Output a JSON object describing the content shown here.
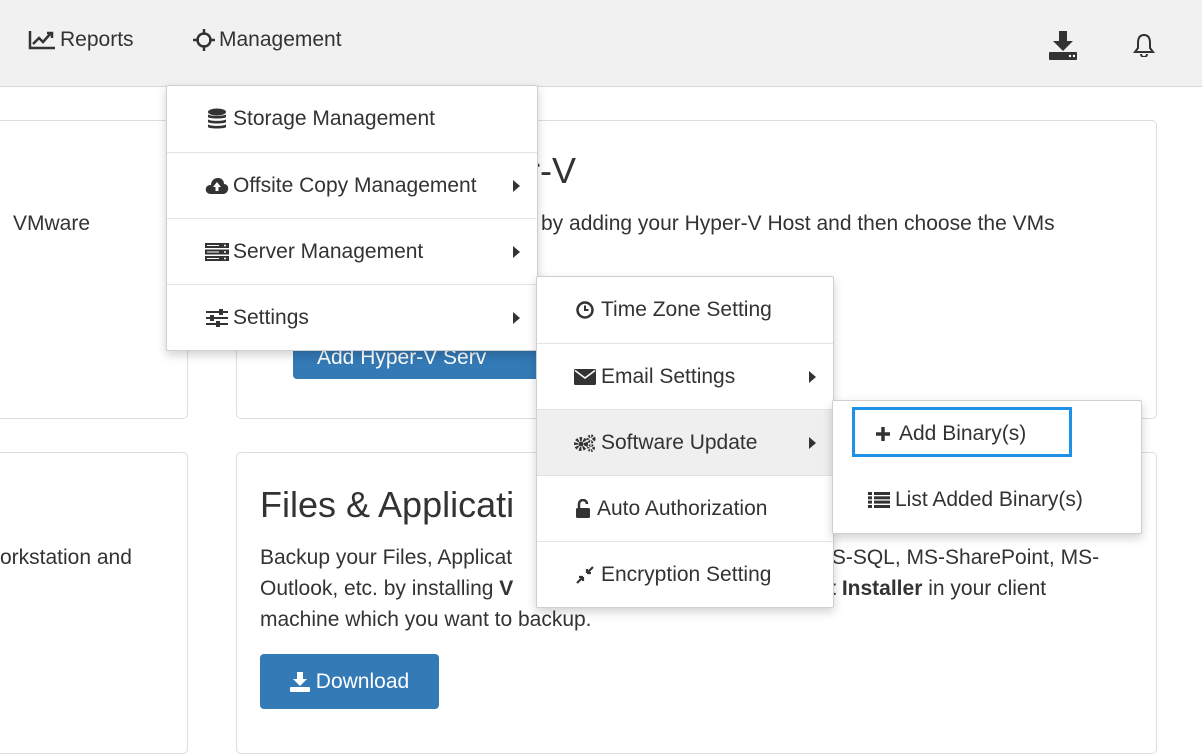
{
  "nav": {
    "reports_label": "Reports",
    "management_label": "Management"
  },
  "background": {
    "left_panel_top_text": "VMware",
    "left_panel_bottom_text": "orkstation and",
    "hyperv_title": "r-V",
    "hyperv_desc": "by adding your Hyper-V Host and then choose the VMs",
    "hyperv_button_partial": "Add Hyper-V Serv",
    "files_title": "Files & Applicati",
    "files_desc_line1_a": "Backup your Files, Applicat",
    "files_desc_line1_b": "IS-SQL, MS-SharePoint, MS-",
    "files_desc_line2_a": "Outlook, etc. by installing ",
    "files_desc_line2_b": "V",
    "files_desc_line2_c": "t Installer",
    "files_desc_line2_d": " in your client",
    "files_desc_line3": "machine which you want to backup.",
    "download_label": "Download"
  },
  "management_menu": {
    "items": [
      {
        "label": "Storage Management",
        "icon": "database-icon",
        "has_submenu": false
      },
      {
        "label": "Offsite Copy Management",
        "icon": "cloud-upload-icon",
        "has_submenu": true
      },
      {
        "label": "Server Management",
        "icon": "server-icon",
        "has_submenu": true
      },
      {
        "label": "Settings",
        "icon": "sliders-icon",
        "has_submenu": true
      }
    ]
  },
  "settings_menu": {
    "items": [
      {
        "label": "Time Zone Setting",
        "icon": "clock-icon",
        "has_submenu": false
      },
      {
        "label": "Email Settings",
        "icon": "envelope-icon",
        "has_submenu": true
      },
      {
        "label": "Software Update",
        "icon": "cogs-icon",
        "has_submenu": true
      },
      {
        "label": "Auto Authorization",
        "icon": "unlock-icon",
        "has_submenu": false
      },
      {
        "label": "Encryption Setting",
        "icon": "compress-icon",
        "has_submenu": false
      }
    ]
  },
  "software_update_menu": {
    "items": [
      {
        "label": "Add Binary(s)",
        "icon": "plus-icon"
      },
      {
        "label": "List Added Binary(s)",
        "icon": "list-icon"
      }
    ]
  },
  "colors": {
    "primary": "#337ab7",
    "focus": "#1e90e6",
    "topbar": "#f1f1f1"
  }
}
